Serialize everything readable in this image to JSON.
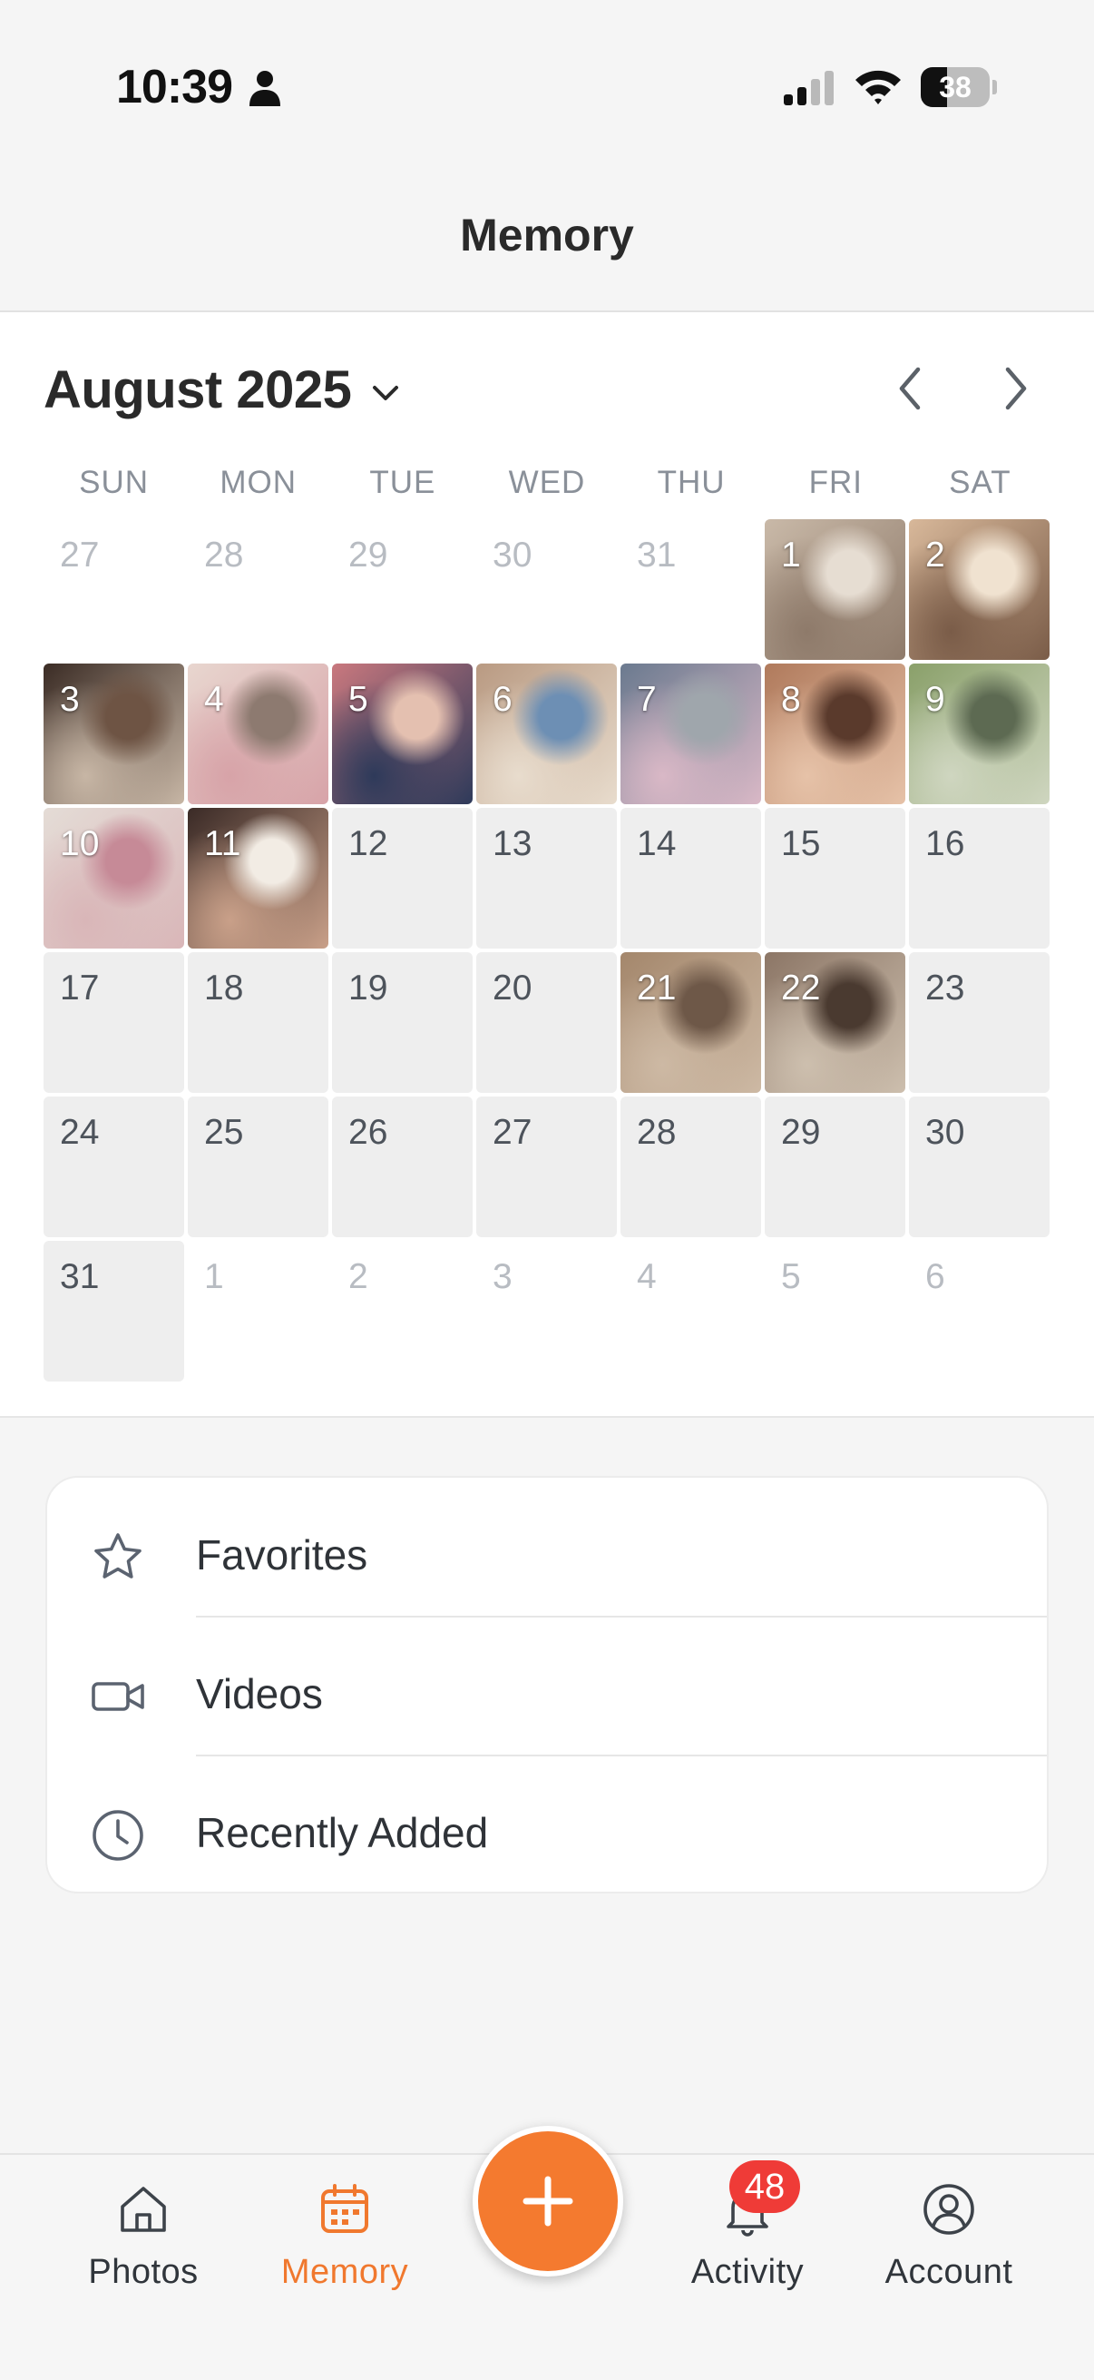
{
  "status_bar": {
    "time": "10:39",
    "battery_level": "38",
    "battery_percent": 38,
    "icons": [
      "person-icon",
      "cellular-signal-icon",
      "wifi-icon",
      "battery-icon"
    ]
  },
  "header": {
    "title": "Memory"
  },
  "calendar": {
    "month_label": "August 2025",
    "icons": [
      "chevron-down-icon",
      "chevron-left-icon",
      "chevron-right-icon"
    ],
    "weekdays": [
      "SUN",
      "MON",
      "TUE",
      "WED",
      "THU",
      "FRI",
      "SAT"
    ],
    "days": [
      {
        "label": "27",
        "in_month": false,
        "has_photo": false
      },
      {
        "label": "28",
        "in_month": false,
        "has_photo": false
      },
      {
        "label": "29",
        "in_month": false,
        "has_photo": false
      },
      {
        "label": "30",
        "in_month": false,
        "has_photo": false
      },
      {
        "label": "31",
        "in_month": false,
        "has_photo": false
      },
      {
        "label": "1",
        "in_month": true,
        "has_photo": true
      },
      {
        "label": "2",
        "in_month": true,
        "has_photo": true
      },
      {
        "label": "3",
        "in_month": true,
        "has_photo": true
      },
      {
        "label": "4",
        "in_month": true,
        "has_photo": true
      },
      {
        "label": "5",
        "in_month": true,
        "has_photo": true
      },
      {
        "label": "6",
        "in_month": true,
        "has_photo": true
      },
      {
        "label": "7",
        "in_month": true,
        "has_photo": true
      },
      {
        "label": "8",
        "in_month": true,
        "has_photo": true
      },
      {
        "label": "9",
        "in_month": true,
        "has_photo": true
      },
      {
        "label": "10",
        "in_month": true,
        "has_photo": true
      },
      {
        "label": "11",
        "in_month": true,
        "has_photo": true
      },
      {
        "label": "12",
        "in_month": true,
        "has_photo": false
      },
      {
        "label": "13",
        "in_month": true,
        "has_photo": false
      },
      {
        "label": "14",
        "in_month": true,
        "has_photo": false
      },
      {
        "label": "15",
        "in_month": true,
        "has_photo": false
      },
      {
        "label": "16",
        "in_month": true,
        "has_photo": false
      },
      {
        "label": "17",
        "in_month": true,
        "has_photo": false
      },
      {
        "label": "18",
        "in_month": true,
        "has_photo": false
      },
      {
        "label": "19",
        "in_month": true,
        "has_photo": false
      },
      {
        "label": "20",
        "in_month": true,
        "has_photo": false
      },
      {
        "label": "21",
        "in_month": true,
        "has_photo": true
      },
      {
        "label": "22",
        "in_month": true,
        "has_photo": true
      },
      {
        "label": "23",
        "in_month": true,
        "has_photo": false
      },
      {
        "label": "24",
        "in_month": true,
        "has_photo": false
      },
      {
        "label": "25",
        "in_month": true,
        "has_photo": false
      },
      {
        "label": "26",
        "in_month": true,
        "has_photo": false
      },
      {
        "label": "27",
        "in_month": true,
        "has_photo": false
      },
      {
        "label": "28",
        "in_month": true,
        "has_photo": false
      },
      {
        "label": "29",
        "in_month": true,
        "has_photo": false
      },
      {
        "label": "30",
        "in_month": true,
        "has_photo": false
      },
      {
        "label": "31",
        "in_month": true,
        "has_photo": false
      },
      {
        "label": "1",
        "in_month": false,
        "has_photo": false
      },
      {
        "label": "2",
        "in_month": false,
        "has_photo": false
      },
      {
        "label": "3",
        "in_month": false,
        "has_photo": false
      },
      {
        "label": "4",
        "in_month": false,
        "has_photo": false
      },
      {
        "label": "5",
        "in_month": false,
        "has_photo": false
      },
      {
        "label": "6",
        "in_month": false,
        "has_photo": false
      }
    ]
  },
  "collections": [
    {
      "label": "Favorites",
      "icon": "star-icon"
    },
    {
      "label": "Videos",
      "icon": "video-camera-icon"
    },
    {
      "label": "Recently Added",
      "icon": "clock-icon"
    }
  ],
  "tab_bar": {
    "photos_label": "Photos",
    "memory_label": "Memory",
    "activity_label": "Activity",
    "account_label": "Account",
    "notification_count": "48",
    "active_tab": "Memory",
    "icons": [
      "home-icon",
      "calendar-icon",
      "plus-icon",
      "bell-icon",
      "account-icon"
    ]
  },
  "colors": {
    "accent": "#f47a2f",
    "badge": "#ef3b37",
    "background": "#f5f5f5",
    "panel": "#ffffff",
    "day_cell": "#eeeeee"
  }
}
